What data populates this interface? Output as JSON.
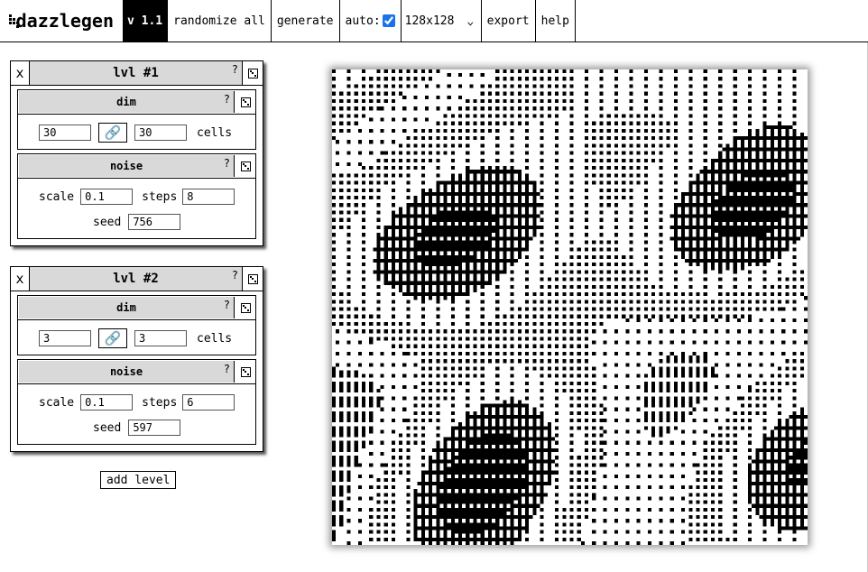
{
  "app": {
    "name": "dazzlegen",
    "version": "v 1.1"
  },
  "toolbar": {
    "randomize_label": "randomize all",
    "generate_label": "generate",
    "auto_label": "auto:",
    "auto_checked": true,
    "size_value": "128x128",
    "export_label": "export",
    "help_label": "help"
  },
  "levels": [
    {
      "title": "lvl #1",
      "dim": {
        "title": "dim",
        "a": "30",
        "b": "30",
        "unit": "cells"
      },
      "noise": {
        "title": "noise",
        "scale_label": "scale",
        "scale": "0.1",
        "steps_label": "steps",
        "steps": "8",
        "seed_label": "seed",
        "seed": "756"
      }
    },
    {
      "title": "lvl #2",
      "dim": {
        "title": "dim",
        "a": "3",
        "b": "3",
        "unit": "cells"
      },
      "noise": {
        "title": "noise",
        "scale_label": "scale",
        "scale": "0.1",
        "steps_label": "steps",
        "steps": "6",
        "seed_label": "seed",
        "seed": "597"
      }
    }
  ],
  "common": {
    "close": "x",
    "help": "?"
  },
  "add_level_label": "add level",
  "colors": {
    "accent": "#1a73e8",
    "panel_header": "#d9d9d9"
  },
  "icons": [
    "x-icon",
    "question-icon",
    "dice-icon",
    "link-icon",
    "chevron-down-icon"
  ]
}
